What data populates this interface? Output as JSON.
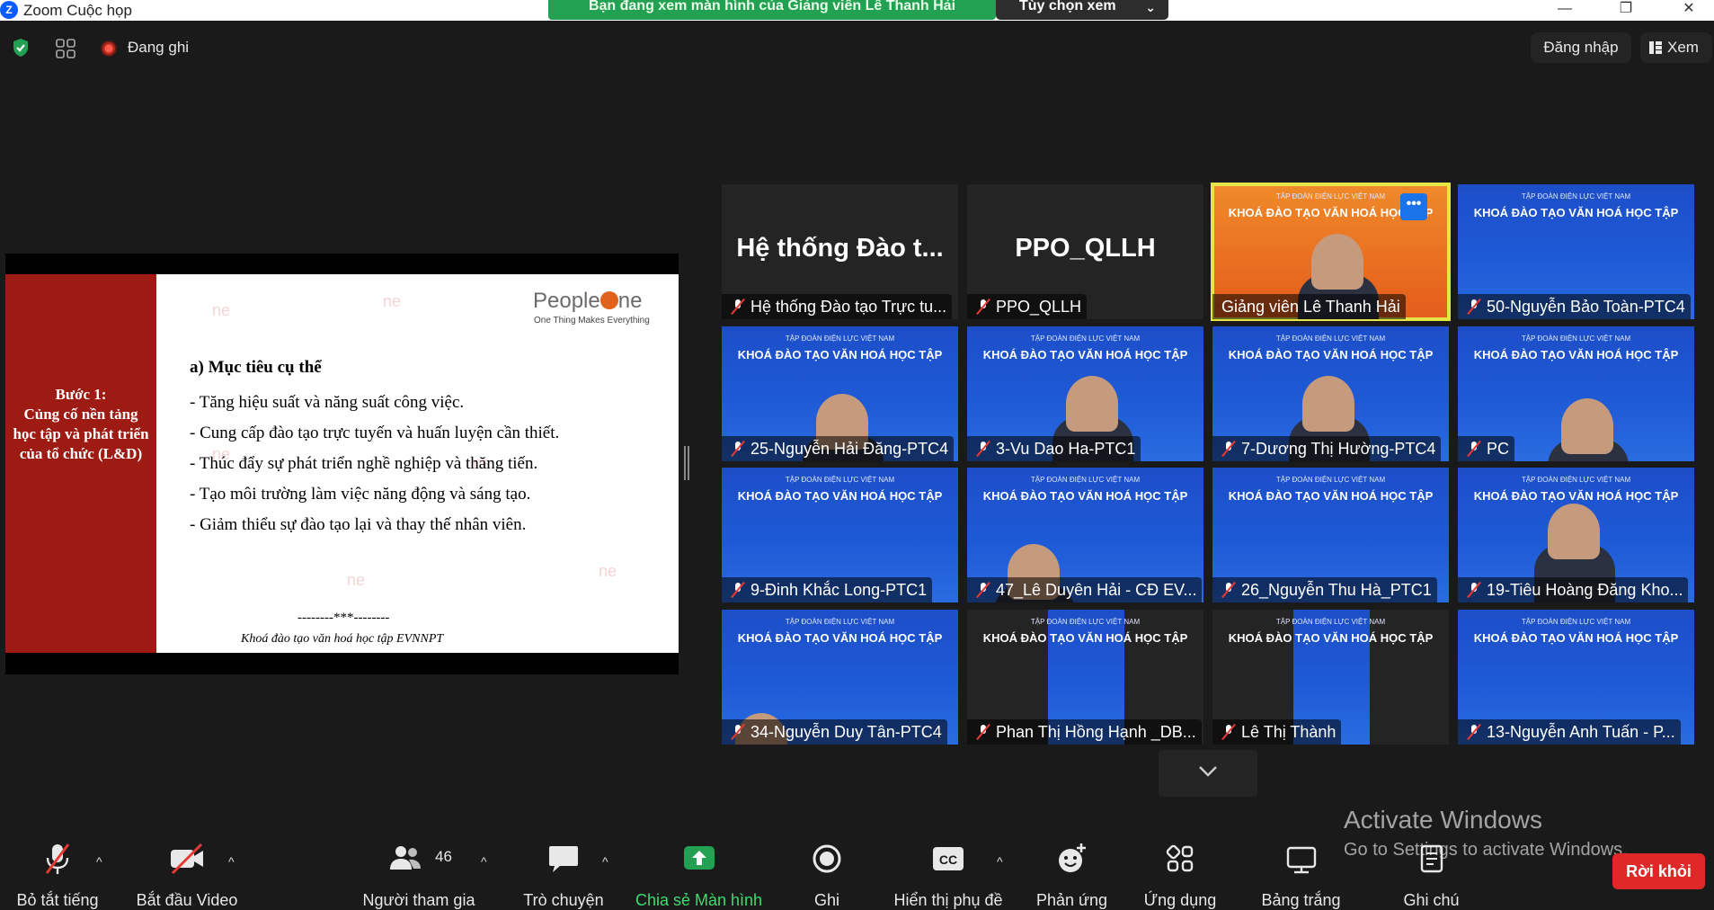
{
  "window": {
    "title": "Zoom Cuộc họp",
    "app_icon_letter": "Z",
    "controls": [
      "—",
      "❐",
      "✕"
    ]
  },
  "share_banner": "Bạn đang xem màn hình của Giảng viên Lê Thanh Hải",
  "view_options": "Tùy chọn xem",
  "top_bar": {
    "recording_label": "Đang ghi",
    "signin_label": "Đăng nhập",
    "view_label": "Xem"
  },
  "slide": {
    "step": [
      "Bước 1:",
      "Củng cố nền tảng",
      "học tập và phát triển",
      "của tổ chức (L&D)"
    ],
    "brand_prefix": "People",
    "brand_suffix": "ne",
    "tagline": "One Thing Makes Everything",
    "heading": "a) Mục tiêu cụ thể",
    "bullets": [
      "- Tăng hiệu suất và năng suất công việc.",
      "- Cung cấp đào tạo trực tuyến và huấn luyện cần thiết.",
      "- Thúc đẩy sự phát triển nghề nghiệp và thăng tiến.",
      "- Tạo môi trường làm việc năng động và sáng tạo.",
      "- Giảm thiểu sự đào tạo lại và thay thế nhân viên."
    ],
    "separator": "--------***--------",
    "footer": "Khoá đào tạo văn hoá học tập EVNNPT"
  },
  "participants": [
    {
      "name": "Hệ thống Đào tạo Trực tu...",
      "big_name": "Hệ thống Đào t...",
      "bg": "dark"
    },
    {
      "name": "PPO_QLLH",
      "big_name": "PPO_QLLH",
      "bg": "dark"
    },
    {
      "name": "Giảng viên Lê Thanh Hải",
      "bg": "orange",
      "active": true
    },
    {
      "name": "50-Nguyễn Bảo Toàn-PTC4",
      "bg": "blue"
    },
    {
      "name": "25-Nguyễn Hải Đăng-PTC4",
      "bg": "blue"
    },
    {
      "name": "3-Vu Dao Ha-PTC1",
      "bg": "blue"
    },
    {
      "name": "7-Dương Thị Hường-PTC4",
      "bg": "blue"
    },
    {
      "name": "PC",
      "bg": "blue"
    },
    {
      "name": "9-Đinh Khắc Long-PTC1",
      "bg": "blue"
    },
    {
      "name": "47_Lê Duyên Hải - CĐ EV...",
      "bg": "blue"
    },
    {
      "name": "26_Nguyễn Thu Hà_PTC1",
      "bg": "blue"
    },
    {
      "name": "19-Tiêu Hoàng Đăng Kho...",
      "bg": "blue"
    },
    {
      "name": "34-Nguyễn Duy Tân-PTC4",
      "bg": "blue"
    },
    {
      "name": "Phan Thị Hồng Hạnh _DB...",
      "bg": "narrow"
    },
    {
      "name": "Lê Thị Thành",
      "bg": "narrow"
    },
    {
      "name": "13-Nguyễn Anh Tuấn - P...",
      "bg": "blue"
    }
  ],
  "tile_banner": "KHOÁ ĐÀO TẠO VĂN HOÁ HỌC TẬP",
  "tile_banner_small": "TẬP ĐOÀN ĐIỆN LỰC VIỆT NAM",
  "activate_windows": {
    "title": "Activate Windows",
    "subtitle": "Go to Settings to activate Windows."
  },
  "toolbar": {
    "mute": "Bỏ tắt tiếng",
    "video": "Bắt đầu Video",
    "participants": "Người tham gia",
    "participants_count": "46",
    "chat": "Trò chuyện",
    "share": "Chia sẻ Màn hình",
    "record": "Ghi",
    "captions": "Hiển thị phụ đề",
    "captions_badge": "CC",
    "reactions": "Phản ứng",
    "apps": "Ứng dụng",
    "whiteboard": "Bảng trắng",
    "notes": "Ghi chú",
    "leave": "Rời khỏi"
  },
  "colors": {
    "share_green": "#23a152",
    "leave_red": "#e02828",
    "active_speaker": "#e5e54a",
    "slide_red": "#9e1b14"
  }
}
